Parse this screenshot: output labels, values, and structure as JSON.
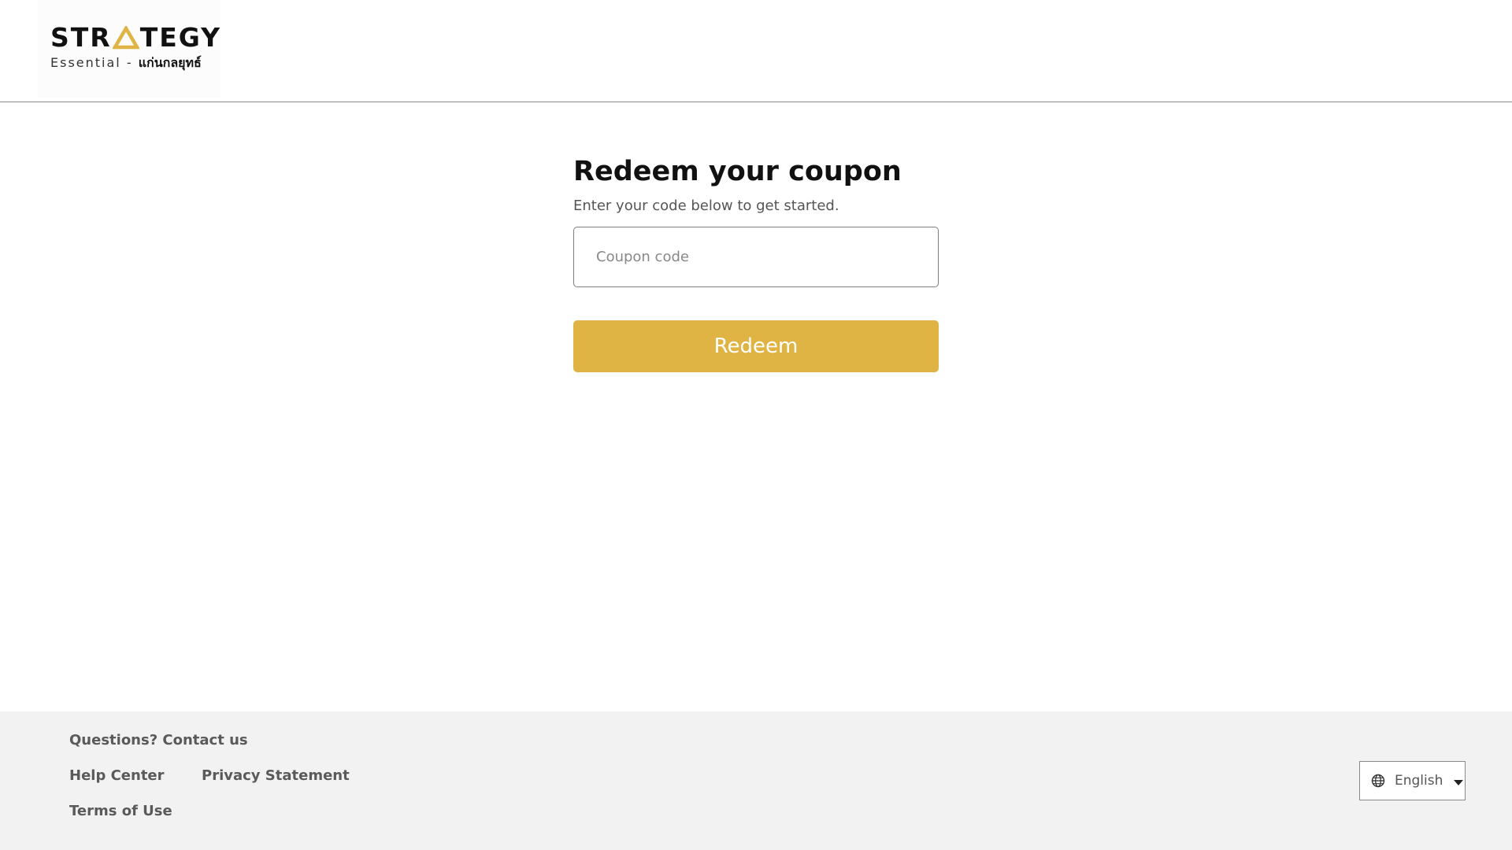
{
  "header": {
    "logo": {
      "wordmark_left": "STR",
      "wordmark_right": "TEGY",
      "sub_left": "Essential - ",
      "sub_thai": "แก่นกลยุทธ์",
      "accent": "#e0b444"
    }
  },
  "main": {
    "title": "Redeem your coupon",
    "subtitle": "Enter your code below to get started.",
    "coupon_placeholder": "Coupon code",
    "coupon_value": "",
    "redeem_label": "Redeem",
    "button_color": "#e0b444"
  },
  "footer": {
    "contact": "Questions? Contact us",
    "help_center": "Help Center",
    "privacy": "Privacy Statement",
    "terms": "Terms of Use",
    "language": {
      "selected": "English",
      "icon": "globe-icon"
    }
  }
}
